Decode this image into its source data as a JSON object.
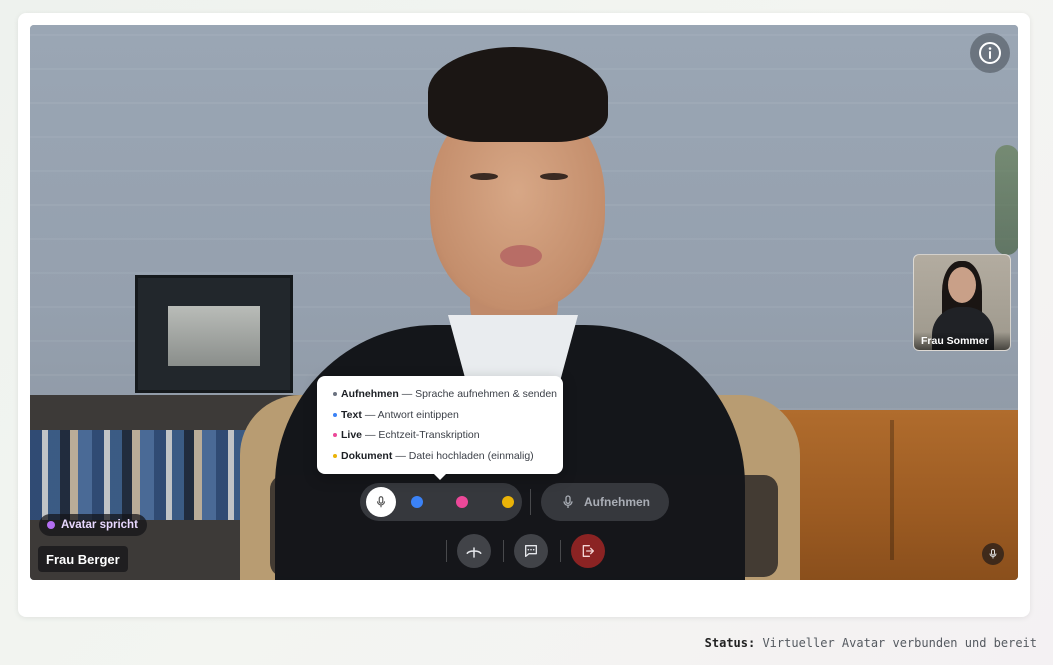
{
  "stage": {
    "main_participant_name": "Frau Berger",
    "speaking_badge": "Avatar spricht",
    "pip_participant_name": "Frau Sommer",
    "info_icon": "info-icon",
    "corner_icon": "microphone-icon"
  },
  "tooltip": {
    "items": [
      {
        "title": "Aufnehmen",
        "desc": "— Sprache aufnehmen & senden",
        "color": "#6b7280"
      },
      {
        "title": "Text",
        "desc": "— Antwort eintippen",
        "color": "#3b82f6"
      },
      {
        "title": "Live",
        "desc": "— Echtzeit-Transkription",
        "color": "#ec4899"
      },
      {
        "title": "Dokument",
        "desc": "— Datei hochladen (einmalig)",
        "color": "#eab308"
      }
    ]
  },
  "controls": {
    "modes": [
      {
        "name": "mode-record",
        "icon": "microphone-icon",
        "color": "#ffffff",
        "active": true
      },
      {
        "name": "mode-text",
        "icon": "dot",
        "color": "#3b82f6"
      },
      {
        "name": "mode-live",
        "icon": "dot",
        "color": "#ec4899"
      },
      {
        "name": "mode-document",
        "icon": "dot",
        "color": "#eab308"
      }
    ],
    "record_label": "Aufnehmen",
    "buttons": [
      {
        "name": "hangup-toggle-button",
        "icon": "phone-down-icon"
      },
      {
        "name": "chat-button",
        "icon": "chat-bubble-icon"
      },
      {
        "name": "leave-button",
        "icon": "exit-icon",
        "color": "#8b2323"
      }
    ]
  },
  "status": {
    "label": "Status:",
    "text": "Virtueller Avatar verbunden und bereit"
  }
}
